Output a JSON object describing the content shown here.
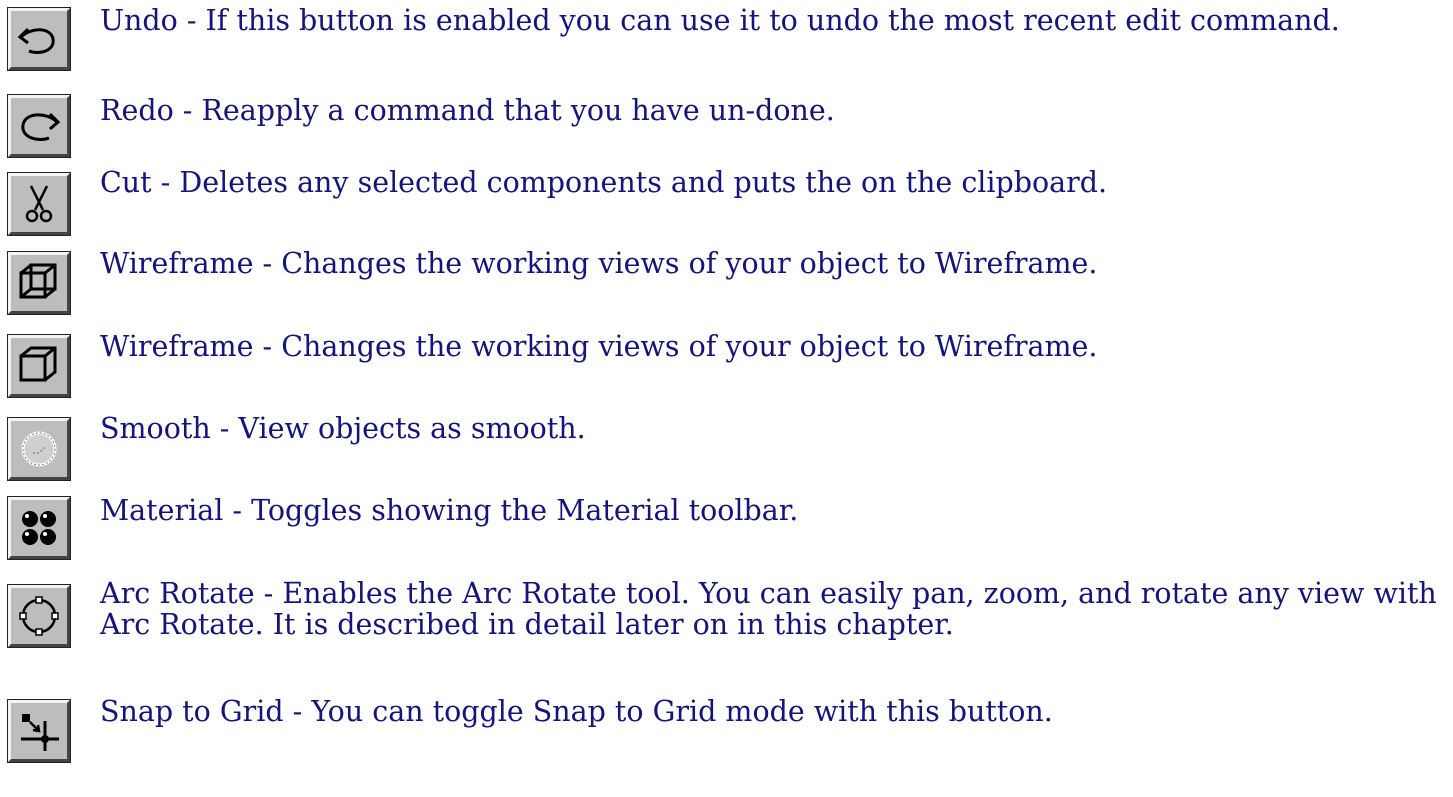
{
  "items": [
    {
      "icon": "undo-icon",
      "text": "Undo - If this button is enabled you can use it to undo the most recent edit command."
    },
    {
      "icon": "redo-icon",
      "text": "Redo - Reapply a command that you have un-done."
    },
    {
      "icon": "cut-icon",
      "text": "Cut - Deletes any selected components and puts the on the clipboard."
    },
    {
      "icon": "wireframe-icon",
      "text": "Wireframe - Changes the working views of your object to Wireframe."
    },
    {
      "icon": "wireframe-solid-icon",
      "text": "Wireframe - Changes the working views of your object to Wireframe."
    },
    {
      "icon": "smooth-icon",
      "text": "Smooth - View objects as smooth."
    },
    {
      "icon": "material-icon",
      "text": "Material - Toggles showing the Material toolbar."
    },
    {
      "icon": "arc-rotate-icon",
      "text": "Arc Rotate - Enables the Arc Rotate tool. You can easily pan, zoom, and rotate any view with Arc Rotate. It is described in detail later on in this chapter."
    },
    {
      "icon": "snap-to-grid-icon",
      "text": "Snap to Grid - You can toggle Snap to Grid mode with this button."
    }
  ]
}
